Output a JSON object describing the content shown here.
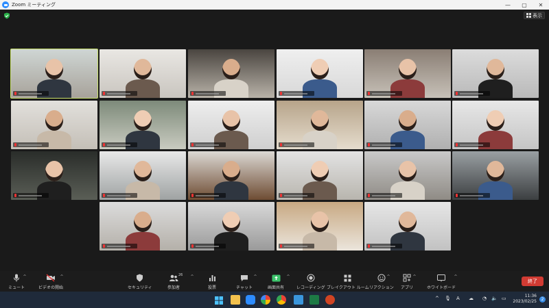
{
  "window": {
    "title": "Zoom ミーティング",
    "controls": [
      "—",
      "▢",
      "✕"
    ]
  },
  "meeting": {
    "view_label": "表示",
    "participant_count": "26"
  },
  "toolbar": {
    "mute": "ミュート",
    "video": "ビデオの開始",
    "security": "セキュリティ",
    "participants": "参加者",
    "polls": "投票",
    "chat": "チャット",
    "share": "画面共有",
    "record": "レコーディング",
    "breakout": "ブレイクアウト ルーム",
    "reactions": "リアクション",
    "apps": "アプリ",
    "whiteboard": "ホワイトボード",
    "end": "終了"
  },
  "taskbar": {
    "ime": "A",
    "time": "11:36",
    "date": "2023/02/25",
    "notifications": "2"
  },
  "colors": {
    "active_speaker": "#c8e06a",
    "end_button": "#d13b33",
    "share_green": "#3cc36b"
  }
}
